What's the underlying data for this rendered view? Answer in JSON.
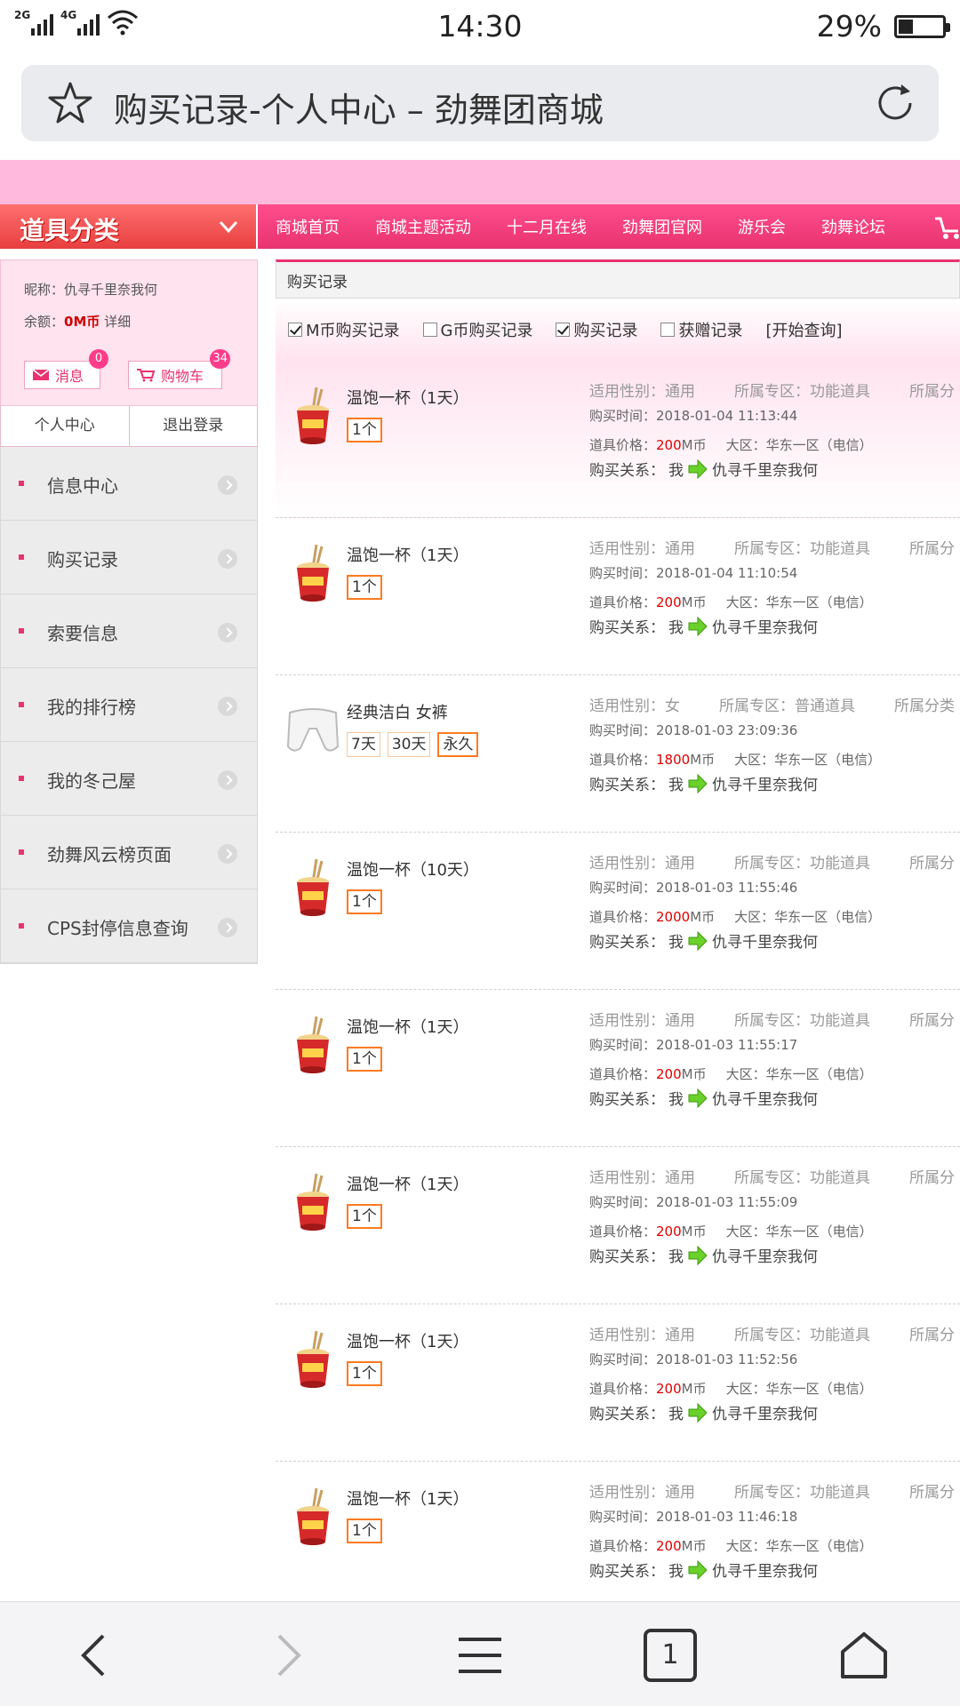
{
  "status": {
    "signal1": "2G",
    "signal2": "4G",
    "time": "14:30",
    "battery": "29%"
  },
  "browser": {
    "title": "购买记录-个人中心 – 劲舞团商城",
    "tab_count": "1"
  },
  "topnav": {
    "category": "道具分类",
    "items": [
      "商城首页",
      "商城主题活动",
      "十二月在线",
      "劲舞团官网",
      "游乐会",
      "劲舞论坛"
    ]
  },
  "sidebar": {
    "nickname": "昵称：仇寻千里奈我何",
    "balance_label": "余额：",
    "balance_value": "0M币",
    "balance_detail": " 详细",
    "msg_label": "消息",
    "msg_badge": "0",
    "cart_label": "购物车",
    "cart_badge": "34",
    "tab_personal": "个人中心",
    "tab_logout": "退出登录",
    "menu": [
      "信息中心",
      "购买记录",
      "索要信息",
      "我的排行榜",
      "我的冬己屋",
      "劲舞风云榜页面",
      "CPS封停信息查询"
    ]
  },
  "main": {
    "header": "购买记录",
    "filters": [
      {
        "label": "M币购买记录",
        "checked": true
      },
      {
        "label": "G币购买记录",
        "checked": false
      },
      {
        "label": "购买记录",
        "checked": true
      },
      {
        "label": "获赠记录",
        "checked": false
      }
    ],
    "query": "[开始查询]",
    "records": [
      {
        "name": "温饱一杯（1天）",
        "icon": "noodle-cup-icon",
        "options": [
          {
            "t": "1个",
            "sel": true
          }
        ],
        "gender_label": "适用性别：",
        "gender": "通用",
        "zone_label": "所属专区：",
        "zone": "功能道具",
        "cat_label": "所属分",
        "time_label": "购买时间：",
        "time": "2018-01-04 11:13:44",
        "price_label": "道具价格：",
        "price": "200",
        "price_unit": "M币",
        "region_label": "大区：",
        "region": "华东一区（电信）",
        "rel_label": "购买关系：",
        "rel_from": "我",
        "rel_to": "仇寻千里奈我何"
      },
      {
        "name": "温饱一杯（1天）",
        "icon": "noodle-cup-icon",
        "options": [
          {
            "t": "1个",
            "sel": true
          }
        ],
        "gender_label": "适用性别：",
        "gender": "通用",
        "zone_label": "所属专区：",
        "zone": "功能道具",
        "cat_label": "所属分",
        "time_label": "购买时间：",
        "time": "2018-01-04 11:10:54",
        "price_label": "道具价格：",
        "price": "200",
        "price_unit": "M币",
        "region_label": "大区：",
        "region": "华东一区（电信）",
        "rel_label": "购买关系：",
        "rel_from": "我",
        "rel_to": "仇寻千里奈我何"
      },
      {
        "name": "经典洁白 女裤",
        "icon": "white-pants-icon",
        "options": [
          {
            "t": "7天",
            "sel": false
          },
          {
            "t": "30天",
            "sel": false
          },
          {
            "t": "永久",
            "sel": true
          }
        ],
        "gender_label": "适用性别：",
        "gender": "女",
        "zone_label": "所属专区：",
        "zone": "普通道具",
        "cat_label": "所属分类",
        "time_label": "购买时间：",
        "time": "2018-01-03 23:09:36",
        "price_label": "道具价格：",
        "price": "1800",
        "price_unit": "M币",
        "region_label": "大区：",
        "region": "华东一区（电信）",
        "rel_label": "购买关系：",
        "rel_from": "我",
        "rel_to": "仇寻千里奈我何"
      },
      {
        "name": "温饱一杯（10天）",
        "icon": "noodle-cup-icon",
        "options": [
          {
            "t": "1个",
            "sel": true
          }
        ],
        "gender_label": "适用性别：",
        "gender": "通用",
        "zone_label": "所属专区：",
        "zone": "功能道具",
        "cat_label": "所属分",
        "time_label": "购买时间：",
        "time": "2018-01-03 11:55:46",
        "price_label": "道具价格：",
        "price": "2000",
        "price_unit": "M币",
        "region_label": "大区：",
        "region": "华东一区（电信）",
        "rel_label": "购买关系：",
        "rel_from": "我",
        "rel_to": "仇寻千里奈我何"
      },
      {
        "name": "温饱一杯（1天）",
        "icon": "noodle-cup-icon",
        "options": [
          {
            "t": "1个",
            "sel": true
          }
        ],
        "gender_label": "适用性别：",
        "gender": "通用",
        "zone_label": "所属专区：",
        "zone": "功能道具",
        "cat_label": "所属分",
        "time_label": "购买时间：",
        "time": "2018-01-03 11:55:17",
        "price_label": "道具价格：",
        "price": "200",
        "price_unit": "M币",
        "region_label": "大区：",
        "region": "华东一区（电信）",
        "rel_label": "购买关系：",
        "rel_from": "我",
        "rel_to": "仇寻千里奈我何"
      },
      {
        "name": "温饱一杯（1天）",
        "icon": "noodle-cup-icon",
        "options": [
          {
            "t": "1个",
            "sel": true
          }
        ],
        "gender_label": "适用性别：",
        "gender": "通用",
        "zone_label": "所属专区：",
        "zone": "功能道具",
        "cat_label": "所属分",
        "time_label": "购买时间：",
        "time": "2018-01-03 11:55:09",
        "price_label": "道具价格：",
        "price": "200",
        "price_unit": "M币",
        "region_label": "大区：",
        "region": "华东一区（电信）",
        "rel_label": "购买关系：",
        "rel_from": "我",
        "rel_to": "仇寻千里奈我何"
      },
      {
        "name": "温饱一杯（1天）",
        "icon": "noodle-cup-icon",
        "options": [
          {
            "t": "1个",
            "sel": true
          }
        ],
        "gender_label": "适用性别：",
        "gender": "通用",
        "zone_label": "所属专区：",
        "zone": "功能道具",
        "cat_label": "所属分",
        "time_label": "购买时间：",
        "time": "2018-01-03 11:52:56",
        "price_label": "道具价格：",
        "price": "200",
        "price_unit": "M币",
        "region_label": "大区：",
        "region": "华东一区（电信）",
        "rel_label": "购买关系：",
        "rel_from": "我",
        "rel_to": "仇寻千里奈我何"
      },
      {
        "name": "温饱一杯（1天）",
        "icon": "noodle-cup-icon",
        "options": [
          {
            "t": "1个",
            "sel": true
          }
        ],
        "gender_label": "适用性别：",
        "gender": "通用",
        "zone_label": "所属专区：",
        "zone": "功能道具",
        "cat_label": "所属分",
        "time_label": "购买时间：",
        "time": "2018-01-03 11:46:18",
        "price_label": "道具价格：",
        "price": "200",
        "price_unit": "M币",
        "region_label": "大区：",
        "region": "华东一区（电信）",
        "rel_label": "购买关系：",
        "rel_from": "我",
        "rel_to": "仇寻千里奈我何"
      }
    ]
  },
  "colors": {
    "accent": "#e8336f",
    "pink_band": "#ffb9dc",
    "price": "#e00000",
    "selected_border": "#ff7a20"
  }
}
